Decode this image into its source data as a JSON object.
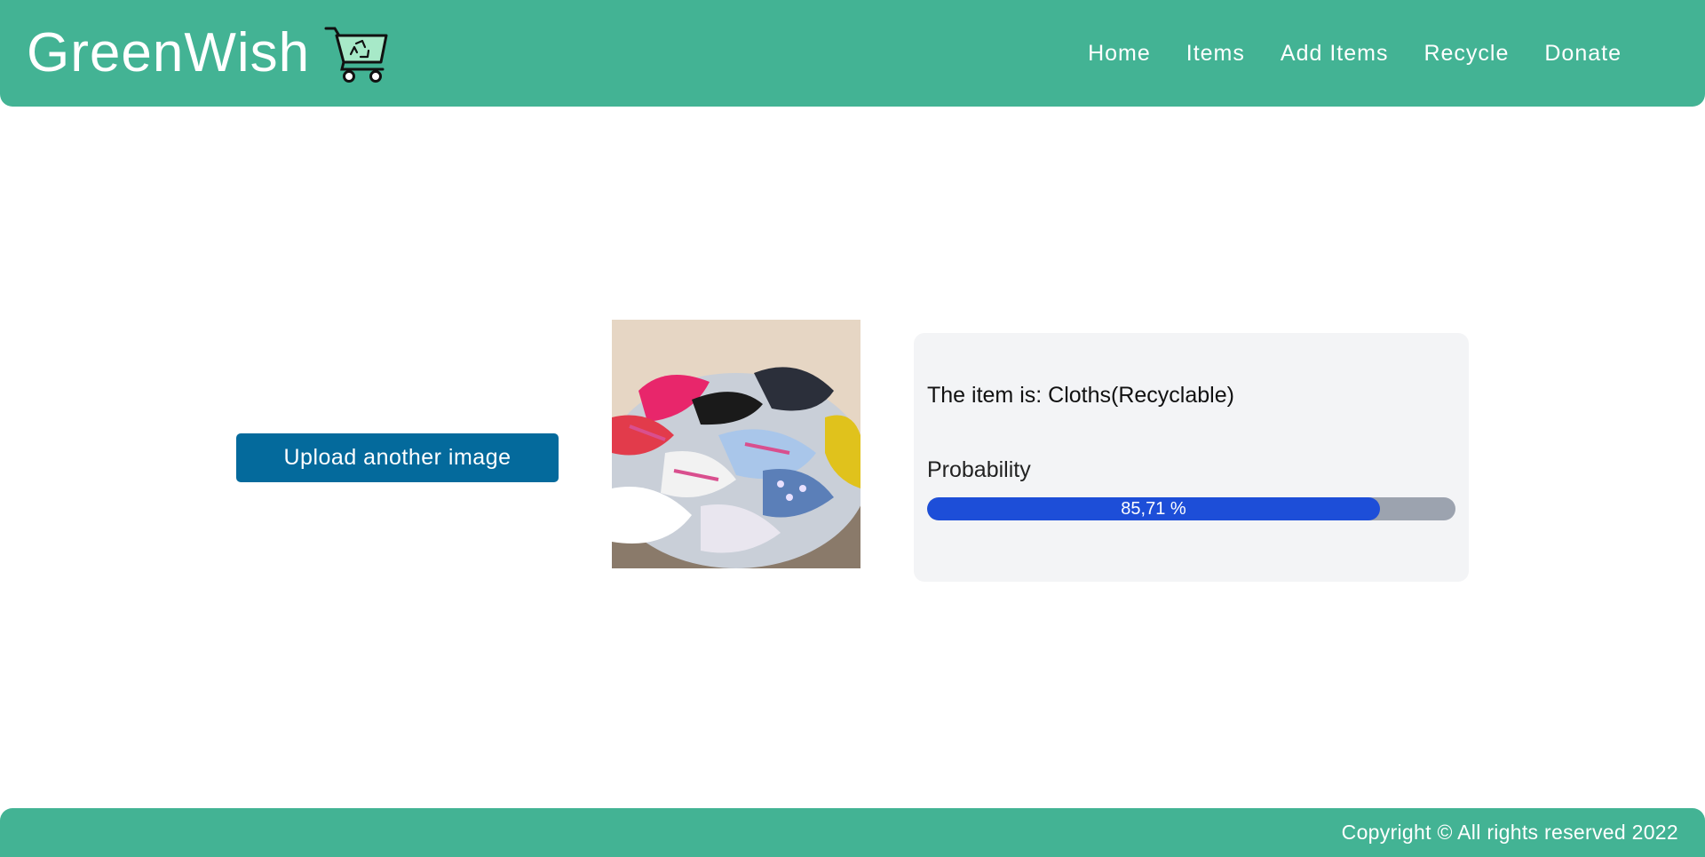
{
  "header": {
    "brand": "GreenWish",
    "logo_icon": "shopping-cart-recycle-icon",
    "nav": [
      {
        "label": "Home"
      },
      {
        "label": "Items"
      },
      {
        "label": "Add Items"
      },
      {
        "label": "Recycle"
      },
      {
        "label": "Donate"
      }
    ]
  },
  "main": {
    "upload_button_label": "Upload another image",
    "result": {
      "label": "The item is: Cloths(Recyclable)",
      "probability_label": "Probability",
      "probability_text": "85,71 %",
      "probability_value": 0.8571
    }
  },
  "footer": {
    "copyright": "Copyright © All rights reserved 2022"
  },
  "colors": {
    "brand_green": "#43b394",
    "button_blue": "#046a9c",
    "progress_fill": "#1d4ed8",
    "progress_track": "#9ca3af"
  }
}
